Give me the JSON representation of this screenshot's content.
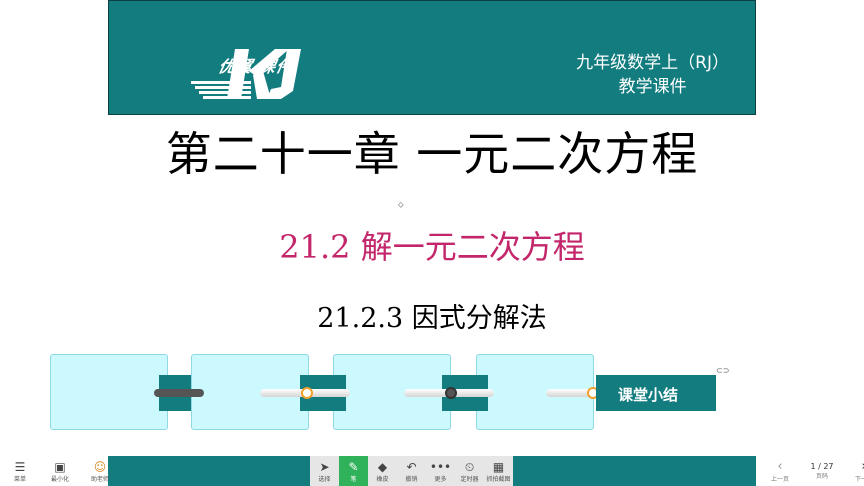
{
  "banner": {
    "logo_text": "优翼 课件",
    "logo_letters": "KJ",
    "grade_line1": "九年级数学上（RJ）",
    "grade_line2": "教学课件",
    "bg_color": "#127c7f"
  },
  "slide": {
    "chapter_title": "第二十一章 一元二次方程",
    "section_title": "21.2 解一元二次方程",
    "subsection_title": "21.2.3 因式分解法",
    "summary_label": "课堂小结",
    "section_color": "#c3266a"
  },
  "toolbar": {
    "left": [
      {
        "icon": "menu-icon",
        "label": "菜单"
      },
      {
        "icon": "minimize-icon",
        "label": "最小化"
      },
      {
        "icon": "teacher-avatar-icon",
        "label": "助老师"
      }
    ],
    "center": [
      {
        "icon": "cursor-icon",
        "label": "选择"
      },
      {
        "icon": "pen-icon",
        "label": "笔"
      },
      {
        "icon": "eraser-icon",
        "label": "橡皮"
      },
      {
        "icon": "undo-icon",
        "label": "撤销"
      },
      {
        "icon": "more-icon",
        "label": "更多"
      },
      {
        "icon": "timer-icon",
        "label": "定时器"
      },
      {
        "icon": "screenshot-icon",
        "label": "抓拍截图"
      }
    ],
    "prev_label": "上一页",
    "page_indicator": "1 / 27",
    "page_label": "页码",
    "next_label": "下一页"
  }
}
